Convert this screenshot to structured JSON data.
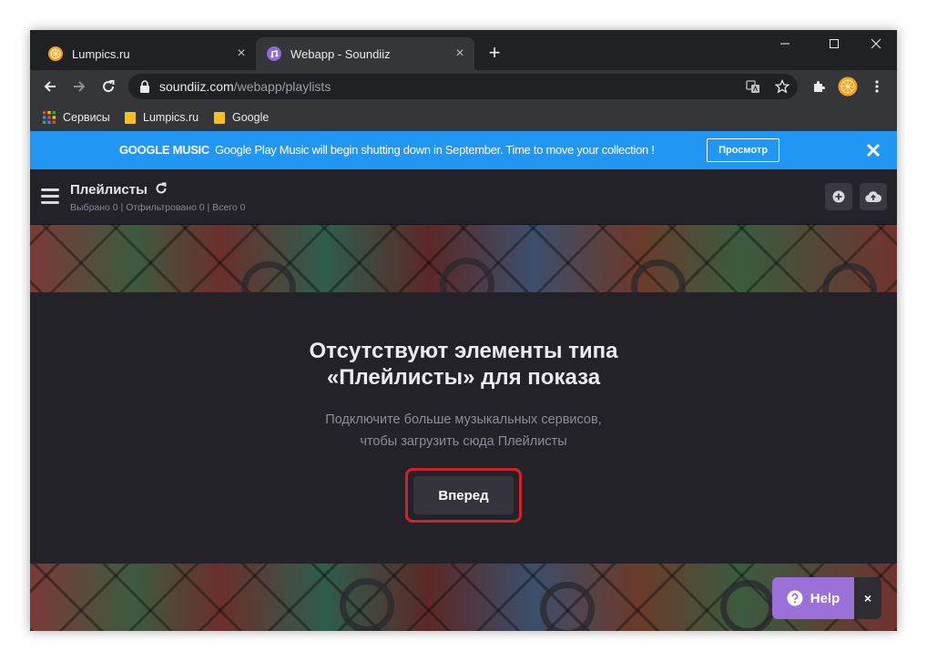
{
  "tabs": [
    {
      "title": "Lumpics.ru",
      "favicon": "orange-icon",
      "active": false
    },
    {
      "title": "Webapp - Soundiiz",
      "favicon": "soundiiz-icon",
      "active": true
    }
  ],
  "address_bar": {
    "host": "soundiiz.com",
    "path": "/webapp/playlists"
  },
  "bookmarks": [
    {
      "label": "Сервисы",
      "icon": "apps-grid-icon"
    },
    {
      "label": "Lumpics.ru",
      "icon": "folder-icon"
    },
    {
      "label": "Google",
      "icon": "folder-icon"
    }
  ],
  "banner": {
    "brand": "GOOGLE MUSIC",
    "message": "Google Play Music will begin shutting down in September. Time to move your collection !",
    "button": "Просмотр",
    "color": "#2196f3"
  },
  "header": {
    "title": "Плейлисты",
    "subtitle": "Выбрано 0 | Отфильтровано 0 | Всего 0"
  },
  "empty_state": {
    "title_line1": "Отсутствуют элементы типа",
    "title_line2": "«Плейлисты» для показа",
    "text_line1": "Подключите больше музыкальных сервисов,",
    "text_line2": "чтобы загрузить сюда Плейлисты",
    "button": "Вперед",
    "highlight_color": "#d3202a"
  },
  "help": {
    "label": "Help",
    "close": "×",
    "color": "#9b70d8"
  }
}
